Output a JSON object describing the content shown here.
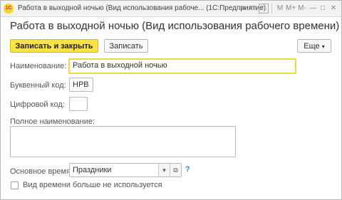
{
  "window": {
    "title": "Работа в выходной ночью (Вид использования рабоче... (1С:Предприятие)",
    "logo_text": "1С",
    "toolbar_icons": [
      "back-icon",
      "copy-icon",
      "calendar-icon",
      "memory-icon",
      "menu-icon",
      "minimize-icon",
      "maximize-icon",
      "close-icon"
    ],
    "toolbar_glyphs": {
      "back": "◂",
      "copy": "▭",
      "calendar": "31",
      "memory": "M",
      "memory_plus": "M+",
      "memory_minus": "M-",
      "minimize": "—",
      "maximize": "□",
      "close": "✕"
    }
  },
  "form": {
    "heading": "Работа в выходной ночью (Вид использования рабочего времени)",
    "buttons": {
      "save_close": "Записать и закрыть",
      "save": "Записать",
      "more": "Еще",
      "more_arrow": "▾"
    },
    "fields": {
      "name_label": "Наименование:",
      "name_value": "Работа в выходной ночью",
      "letter_code_label": "Буквенный код:",
      "letter_code_value": "НРВ",
      "digit_code_label": "Цифровой код:",
      "digit_code_value": "",
      "full_name_label": "Полное наименование:",
      "full_name_value": "",
      "main_time_label": "Основное время:",
      "main_time_value": "Праздники",
      "main_time_dropdown": "▾",
      "main_time_open": "⧉",
      "help": "?",
      "unused_label": "Вид времени больше не используется",
      "unused_checked": false
    }
  }
}
